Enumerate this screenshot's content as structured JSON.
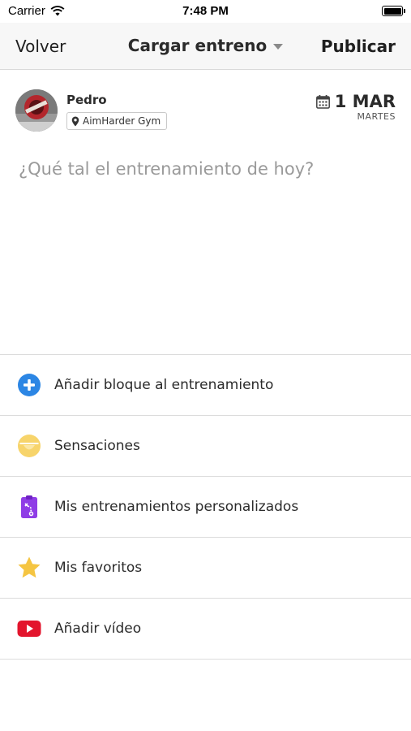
{
  "status_bar": {
    "carrier": "Carrier",
    "time": "7:48 PM",
    "wifi_icon": "wifi-icon",
    "battery_icon": "battery-icon"
  },
  "nav": {
    "back_label": "Volver",
    "title": "Cargar entreno",
    "title_icon": "caret-down-icon",
    "publish_label": "Publicar"
  },
  "post": {
    "user_name": "Pedro",
    "gym": "AimHarder Gym",
    "gym_icon": "location-pin-icon",
    "date_icon": "calendar-icon",
    "date": "1 MAR",
    "weekday": "MARTES",
    "compose_placeholder": "¿Qué tal el entrenamiento de hoy?"
  },
  "options": [
    {
      "label": "Añadir bloque al entrenamiento",
      "icon": "plus-circle-icon",
      "color": "#2c86e4"
    },
    {
      "label": "Sensaciones",
      "icon": "face-icon",
      "color": "#f7d46b"
    },
    {
      "label": "Mis entrenamientos personalizados",
      "icon": "clipboard-icon",
      "color": "#8f3de6"
    },
    {
      "label": "Mis favoritos",
      "icon": "star-icon",
      "color": "#f5c542"
    },
    {
      "label": "Añadir vídeo",
      "icon": "video-play-icon",
      "color": "#e3152d"
    }
  ]
}
